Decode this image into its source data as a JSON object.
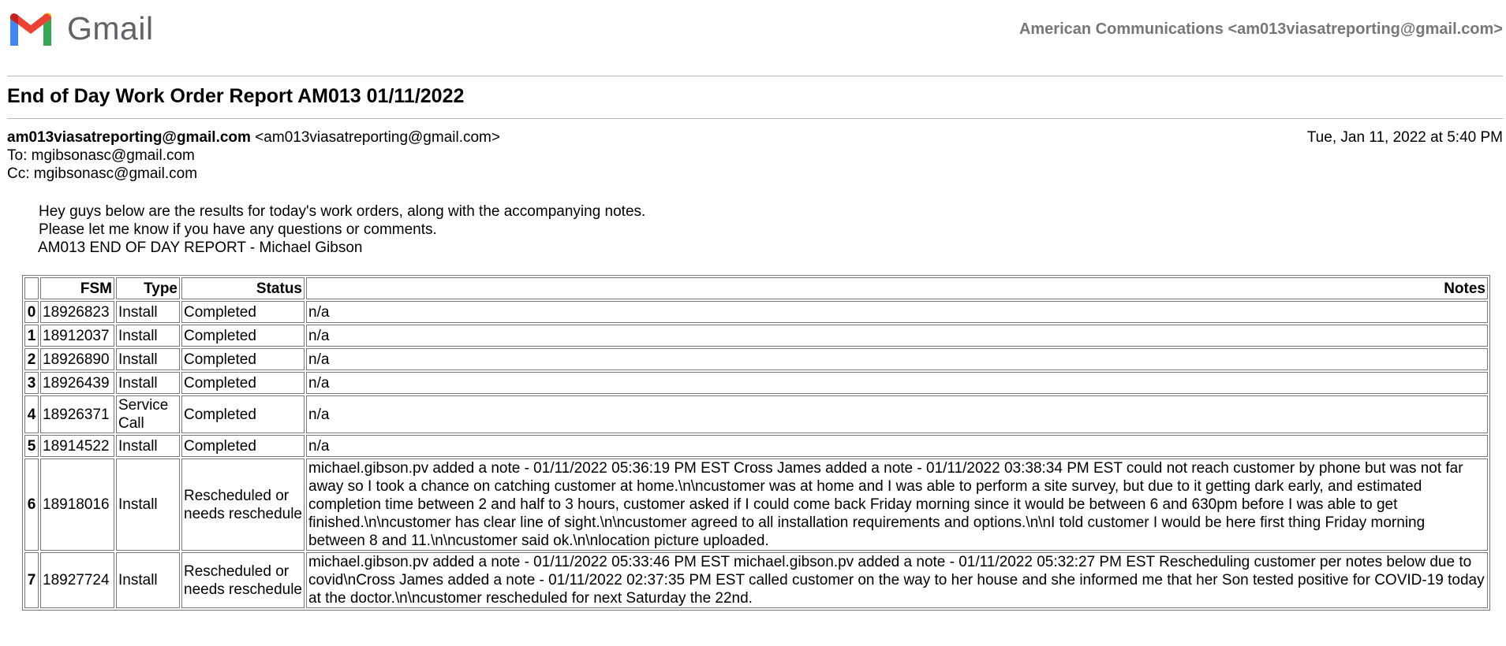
{
  "app": {
    "name": "Gmail",
    "brand_colors": {
      "blue": "#4285F4",
      "red": "#EA4335",
      "yellow": "#FBBC04",
      "green": "#34A853"
    }
  },
  "header": {
    "account": "American Communications <am013viasatreporting@gmail.com>"
  },
  "email": {
    "subject": "End of Day Work Order Report AM013 01/11/2022",
    "from_name": "am013viasatreporting@gmail.com",
    "from_address": "<am013viasatreporting@gmail.com>",
    "date": "Tue, Jan 11, 2022 at 5:40 PM",
    "to": "To: mgibsonasc@gmail.com",
    "cc": "Cc: mgibsonasc@gmail.com",
    "body_lines": [
      "Hey guys below are the results for today's work orders, along with the accompanying notes.",
      "Please let me know if you have any questions or comments.",
      "AM013 END OF DAY REPORT - Michael Gibson"
    ]
  },
  "table": {
    "headers": [
      "",
      "FSM",
      "Type",
      "Status",
      "Notes"
    ],
    "rows": [
      {
        "idx": "0",
        "fsm": "18926823",
        "type": "Install",
        "status": "Completed",
        "notes": "n/a"
      },
      {
        "idx": "1",
        "fsm": "18912037",
        "type": "Install",
        "status": "Completed",
        "notes": "n/a"
      },
      {
        "idx": "2",
        "fsm": "18926890",
        "type": "Install",
        "status": "Completed",
        "notes": "n/a"
      },
      {
        "idx": "3",
        "fsm": "18926439",
        "type": "Install",
        "status": "Completed",
        "notes": "n/a"
      },
      {
        "idx": "4",
        "fsm": "18926371",
        "type": "Service Call",
        "status": "Completed",
        "notes": "n/a"
      },
      {
        "idx": "5",
        "fsm": "18914522",
        "type": "Install",
        "status": "Completed",
        "notes": "n/a"
      },
      {
        "idx": "6",
        "fsm": "18918016",
        "type": "Install",
        "status": "Rescheduled or needs reschedule",
        "notes": "michael.gibson.pv added a note - 01/11/2022 05:36:19 PM EST Cross James added a note - 01/11/2022 03:38:34 PM EST could not reach customer by phone but was not far away so I took a chance on catching customer at home.\\n\\ncustomer was at home and I was able to perform a site survey, but due to it getting dark early, and estimated completion time between 2 and half to 3 hours, customer asked if I could come back Friday morning since it would be between 6 and 630pm before I was able to get finished.\\n\\ncustomer has clear line of sight.\\n\\ncustomer agreed to all installation requirements and options.\\n\\nI told customer I would be here first thing Friday morning between 8 and 11.\\n\\ncustomer said ok.\\n\\nlocation picture uploaded."
      },
      {
        "idx": "7",
        "fsm": "18927724",
        "type": "Install",
        "status": "Rescheduled or needs reschedule",
        "notes": "michael.gibson.pv added a note - 01/11/2022 05:33:46 PM EST michael.gibson.pv added a note - 01/11/2022 05:32:27 PM EST Rescheduling customer per notes below due to covid\\nCross James added a note - 01/11/2022 02:37:35 PM EST called customer on the way to her house and she informed me that her Son tested positive for COVID-19 today at the doctor.\\n\\ncustomer rescheduled for next Saturday the 22nd."
      }
    ]
  }
}
